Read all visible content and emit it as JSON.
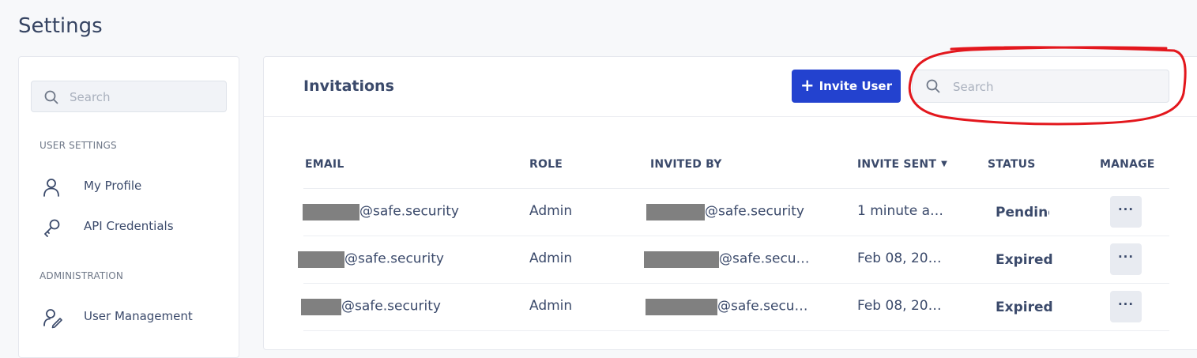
{
  "page": {
    "title": "Settings"
  },
  "sidebar": {
    "search_placeholder": "Search",
    "sections": [
      {
        "label": "USER SETTINGS",
        "items": [
          {
            "label": "My Profile",
            "icon": "user-icon"
          },
          {
            "label": "API Credentials",
            "icon": "key-icon"
          }
        ]
      },
      {
        "label": "ADMINISTRATION",
        "items": [
          {
            "label": "User Management",
            "icon": "user-edit-icon"
          }
        ]
      }
    ]
  },
  "main": {
    "title": "Invitations",
    "invite_button_label": "Invite User",
    "search_placeholder": "Search",
    "columns": [
      "EMAIL",
      "ROLE",
      "INVITED BY",
      "INVITE SENT",
      "STATUS",
      "MANAGE"
    ],
    "rows": [
      {
        "email_domain": "@safe.security",
        "role": "Admin",
        "invited_by_domain": "@safe.security",
        "invite_sent": "1 minute a…",
        "status": "Pending"
      },
      {
        "email_domain": "@safe.security",
        "role": "Admin",
        "invited_by_domain": "@safe.secu…",
        "invite_sent": "Feb 08, 20…",
        "status": "Expired"
      },
      {
        "email_domain": "@safe.security",
        "role": "Admin",
        "invited_by_domain": "@safe.secu…",
        "invite_sent": "Feb 08, 20…",
        "status": "Expired"
      }
    ],
    "manage_label": "···"
  },
  "colors": {
    "accent": "#2342cf",
    "annotation": "#e3171d",
    "redaction": "#808080"
  }
}
